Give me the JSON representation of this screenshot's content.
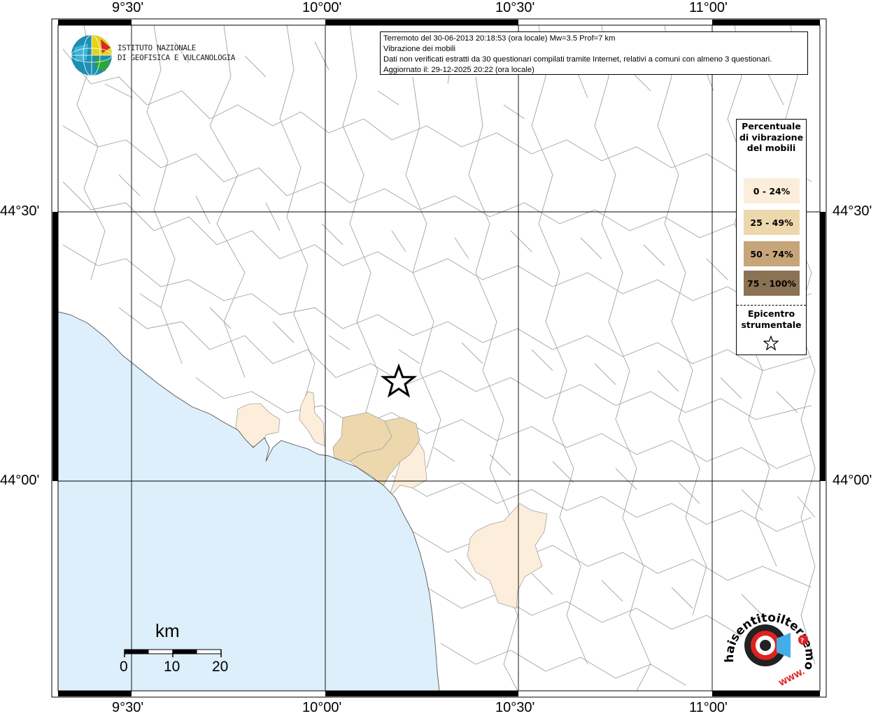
{
  "map": {
    "lon_labels": [
      "9°30'",
      "10°00'",
      "10°30'",
      "11°00'"
    ],
    "lat_labels": [
      "44°30'",
      "44°00'"
    ]
  },
  "info": {
    "line1": "Terremoto del 30-06-2013 20:18:53 (ora locale) Mw=3.5 Prof=7 km",
    "line2": "Vibrazione dei mobili",
    "line3": "Dati non verificati estratti da 30 questionari compilati tramite Internet, relativi a comuni con almeno 3 questionari.",
    "line4": "Aggiornato il: 29-12-2025 20:22 (ora locale)"
  },
  "logo": {
    "line1": "ISTITUTO NAZIONALE",
    "line2": "DI GEOFISICA E VULCANOLOGIA"
  },
  "legend": {
    "title": "Percentuale di vibrazione del mobili",
    "items": [
      {
        "label": "0 - 24%",
        "color": "#FCEEDB"
      },
      {
        "label": "25 - 49%",
        "color": "#EDD8AE"
      },
      {
        "label": "50 - 74%",
        "color": "#C7A57A"
      },
      {
        "label": "75 - 100%",
        "color": "#8C7254"
      }
    ],
    "epicenter_label": "Epicentro strumentale",
    "epicenter_icon": "star-outline-icon"
  },
  "scale": {
    "unit": "km",
    "labels": [
      "0",
      "10",
      "20"
    ]
  },
  "colors": {
    "sea": "#DDEFFB",
    "boundary": "#9a9a9a",
    "grid": "#000000"
  },
  "watermark": {
    "text": "haisentitoilterremoto.it",
    "www": "WWW."
  }
}
